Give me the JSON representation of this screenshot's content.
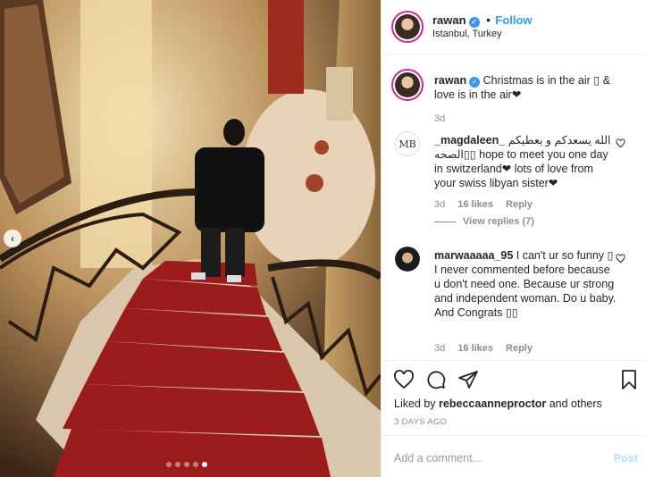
{
  "header": {
    "username": "rawan",
    "follow_label": "Follow",
    "bullet": "•",
    "location": "Istanbul, Turkey"
  },
  "caption": {
    "username": "rawan",
    "text": "Christmas is in the air ▯ & love is in the air❤",
    "time": "3d"
  },
  "comments": [
    {
      "username": "_magdaleen_",
      "text": "الله يسعدكم و يعطيكم الصحه▯▯ hope to meet you one day in switzerland❤ lots of love from your swiss libyan sister❤",
      "time": "3d",
      "likes": "16 likes",
      "reply_label": "Reply",
      "view_replies": "View replies (7)",
      "avatar_text": "MB"
    },
    {
      "username": "marwaaaaa_95",
      "text": "I can't ur so funny ▯ I never commented before because u don't need one. Because ur strong and independent woman. Do u baby. And Congrats ▯▯",
      "time": "3d",
      "likes": "16 likes",
      "reply_label": "Reply"
    }
  ],
  "likes": {
    "prefix": "Liked by",
    "user": "rebeccaanneproctor",
    "suffix": "and others"
  },
  "posted_ago": "3 DAYS AGO",
  "add_comment": {
    "placeholder": "Add a comment...",
    "post_label": "Post"
  },
  "carousel": {
    "total": 5,
    "active_index": 4
  },
  "icons": [
    "verified-icon",
    "heart-icon",
    "comment-icon",
    "share-icon",
    "bookmark-icon",
    "chevron-left-icon"
  ],
  "colors": {
    "link": "#3897f0",
    "muted": "#8e8e8e",
    "post_disabled": "#b2dffc",
    "carpet": "#9c1b1b"
  }
}
